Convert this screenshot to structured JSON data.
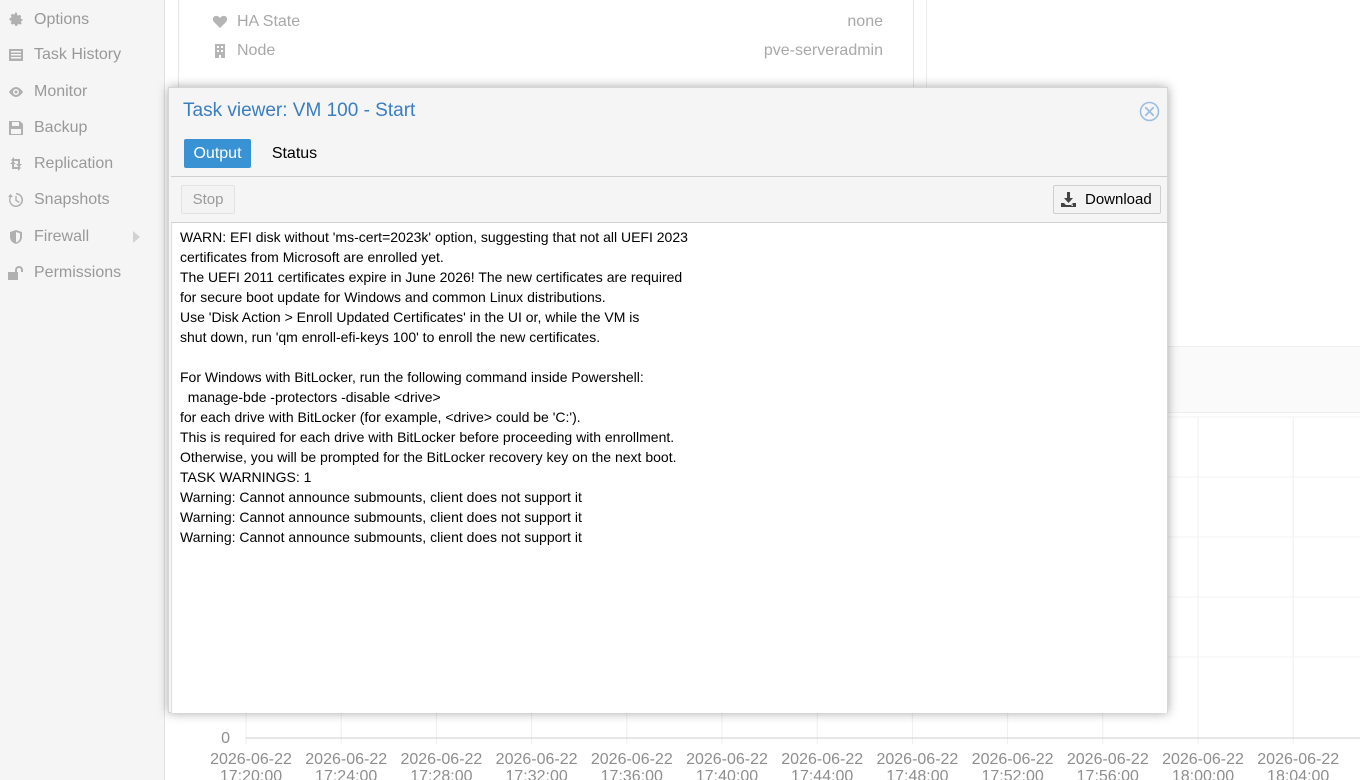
{
  "nav": {
    "items": [
      {
        "label": "Options",
        "icon": "gear-icon"
      },
      {
        "label": "Task History",
        "icon": "list-icon"
      },
      {
        "label": "Monitor",
        "icon": "eye-icon"
      },
      {
        "label": "Backup",
        "icon": "floppy-icon"
      },
      {
        "label": "Replication",
        "icon": "retweet-icon"
      },
      {
        "label": "Snapshots",
        "icon": "history-icon"
      },
      {
        "label": "Firewall",
        "icon": "shield-icon"
      },
      {
        "label": "Permissions",
        "icon": "unlock-icon"
      }
    ]
  },
  "status": {
    "rows": [
      {
        "label": "HA State",
        "value": "none",
        "icon": "heartbeat-icon"
      },
      {
        "label": "Node",
        "value": "pve-serveradmin",
        "icon": "building-icon"
      }
    ]
  },
  "chart_data": {
    "type": "line",
    "y_ticks": [
      "0"
    ],
    "x_ticks": [
      {
        "date": "2026-06-22",
        "time": "17:20:00"
      },
      {
        "date": "2026-06-22",
        "time": "17:24:00"
      },
      {
        "date": "2026-06-22",
        "time": "17:28:00"
      },
      {
        "date": "2026-06-22",
        "time": "17:32:00"
      },
      {
        "date": "2026-06-22",
        "time": "17:36:00"
      },
      {
        "date": "2026-06-22",
        "time": "17:40:00"
      },
      {
        "date": "2026-06-22",
        "time": "17:44:00"
      },
      {
        "date": "2026-06-22",
        "time": "17:48:00"
      },
      {
        "date": "2026-06-22",
        "time": "17:52:00"
      },
      {
        "date": "2026-06-22",
        "time": "17:56:00"
      },
      {
        "date": "2026-06-22",
        "time": "18:00:00"
      },
      {
        "date": "2026-06-22",
        "time": "18:04:00"
      }
    ],
    "series": []
  },
  "dialog": {
    "title": "Task viewer: VM 100 - Start",
    "tabs": [
      "Output",
      "Status"
    ],
    "stop_label": "Stop",
    "download_label": "Download",
    "log_lines": [
      "WARN: EFI disk without 'ms-cert=2023k' option, suggesting that not all UEFI 2023",
      "certificates from Microsoft are enrolled yet.",
      "The UEFI 2011 certificates expire in June 2026! The new certificates are required",
      "for secure boot update for Windows and common Linux distributions.",
      "Use 'Disk Action > Enroll Updated Certificates' in the UI or, while the VM is",
      "shut down, run 'qm enroll-efi-keys 100' to enroll the new certificates.",
      "",
      "For Windows with BitLocker, run the following command inside Powershell:",
      "  manage-bde -protectors -disable <drive>",
      "for each drive with BitLocker (for example, <drive> could be 'C:').",
      "This is required for each drive with BitLocker before proceeding with enrollment.",
      "Otherwise, you will be prompted for the BitLocker recovery key on the next boot.",
      "TASK WARNINGS: 1",
      "Warning: Cannot announce submounts, client does not support it",
      "Warning: Cannot announce submounts, client does not support it",
      "Warning: Cannot announce submounts, client does not support it"
    ]
  },
  "colors": {
    "accent": "#3892d4",
    "title": "#3a7ec2",
    "close_icon": "#9bbfe0"
  }
}
